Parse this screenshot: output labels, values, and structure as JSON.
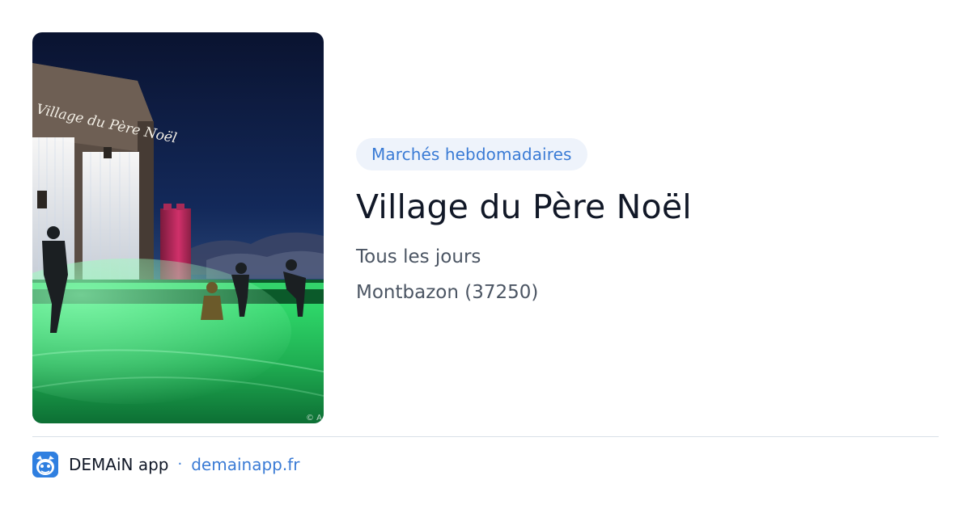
{
  "card": {
    "image_credit": "© A",
    "tag": "Marchés hebdomadaires",
    "title": "Village du Père Noël",
    "schedule": "Tous les jours",
    "location": "Montbazon (37250)",
    "image_sign_text": "Village du Père Noël"
  },
  "footer": {
    "app_name": "DEMAiN app",
    "separator": "·",
    "site": "demainapp.fr",
    "logo_icon": "demain-app-logo-icon"
  },
  "colors": {
    "tag_bg": "#eef3fb",
    "accent": "#3a7bd5",
    "title": "#111827",
    "muted": "#4b5563",
    "divider": "#d8e0e8"
  }
}
